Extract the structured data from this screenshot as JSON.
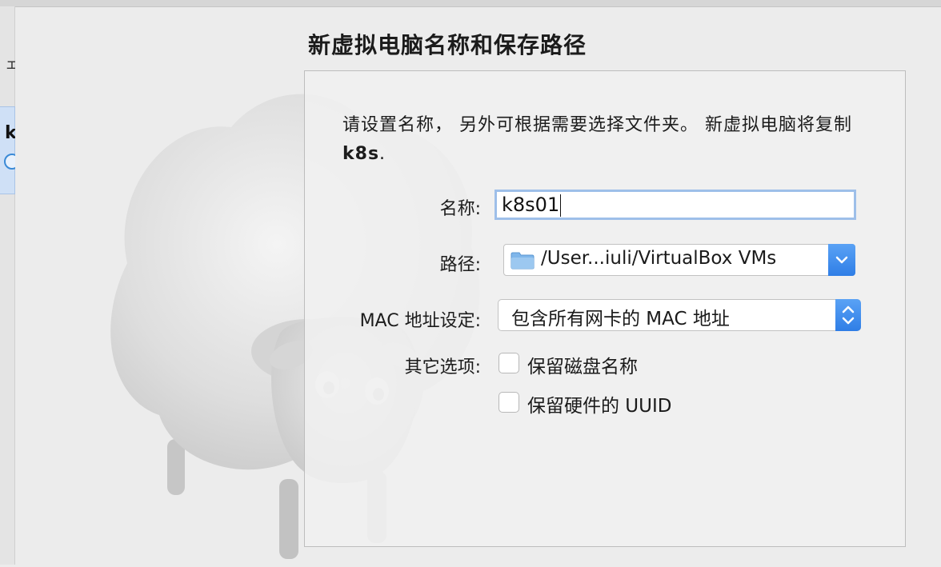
{
  "background": {
    "left_glyph": "ェ",
    "selected_vm_initial": "k"
  },
  "sheet": {
    "title": "新虚拟电脑名称和保存路径",
    "description": "请设置名称， 另外可根据需要选择文件夹。 新虚拟电脑将复制",
    "source_vm": "k8s",
    "source_suffix": ".",
    "fields": {
      "name_label": "名称:",
      "name_value": "k8s01",
      "path_label": "路径:",
      "path_value": "/User...iuli/VirtualBox VMs",
      "mac_label": "MAC 地址设定:",
      "mac_value": "包含所有网卡的 MAC 地址",
      "other_label": "其它选项:",
      "keep_disk_names_label": "保留磁盘名称",
      "keep_disk_names_checked": false,
      "keep_hw_uuid_label": "保留硬件的 UUID",
      "keep_hw_uuid_checked": false
    }
  },
  "colors": {
    "accent": "#3a8ad6",
    "focus_ring": "#9ebfe9",
    "folder": "#7fb6ea"
  }
}
